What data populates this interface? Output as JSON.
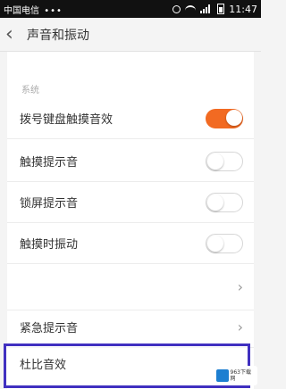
{
  "status_bar": {
    "carrier": "中国电信",
    "dots": "•••",
    "time": "11:47"
  },
  "app_bar": {
    "title": "声音和振动"
  },
  "section": {
    "label": "系统"
  },
  "settings": [
    {
      "label": "拨号键盘触摸音效",
      "control": "toggle",
      "on": true
    },
    {
      "label": "触摸提示音",
      "control": "toggle",
      "on": false
    },
    {
      "label": "锁屏提示音",
      "control": "toggle",
      "on": false
    },
    {
      "label": "触摸时振动",
      "control": "toggle",
      "on": false
    },
    {
      "label": "紧急提示音",
      "control": "chevron"
    },
    {
      "label": "杜比音效",
      "control": "none"
    }
  ],
  "watermark": {
    "text": "963下载网"
  },
  "colors": {
    "toggle_on": "#f26a22",
    "highlight_border": "#4030c0"
  }
}
